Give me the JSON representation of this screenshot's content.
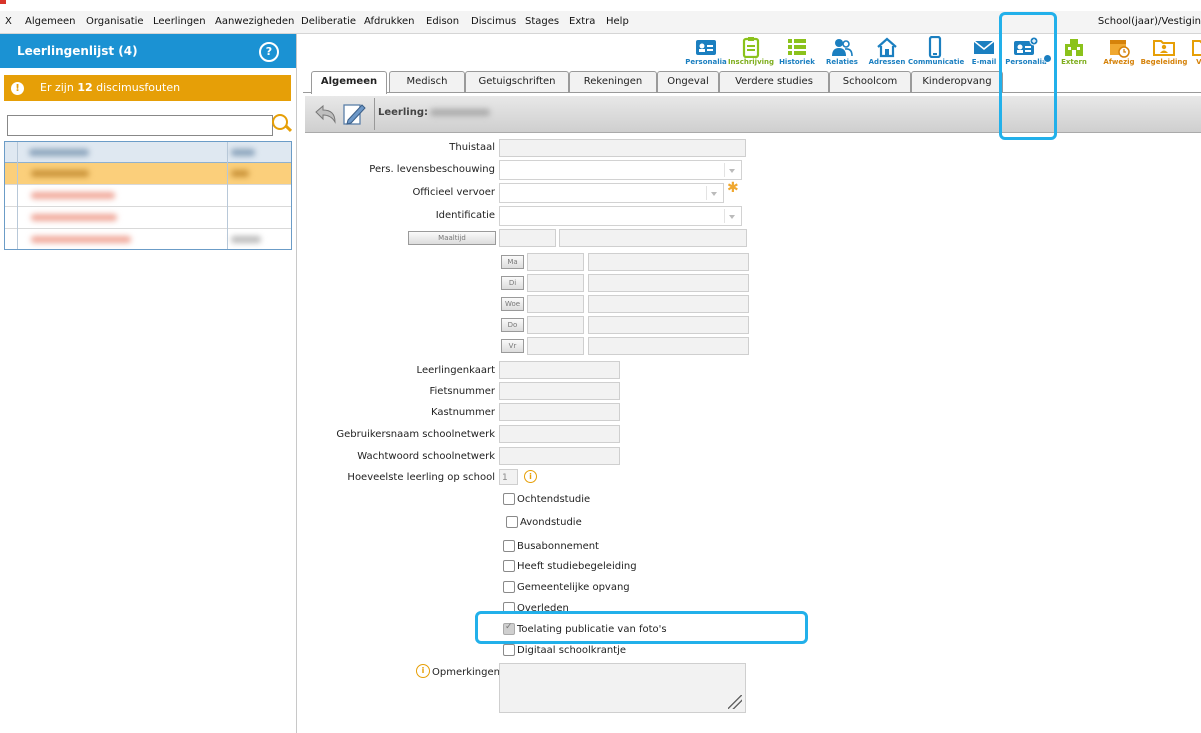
{
  "menubar": {
    "items": [
      "X",
      "Algemeen",
      "Organisatie",
      "Leerlingen",
      "Aanwezigheden",
      "Deliberatie",
      "Afdrukken",
      "Edison",
      "Discimus",
      "Stages",
      "Extra",
      "Help"
    ],
    "right": "School(jaar)/Vestigin"
  },
  "leftpane": {
    "title": "Leerlingenlijst (4)",
    "warning_prefix": "Er zijn ",
    "warning_count": "12",
    "warning_suffix": " discimusfouten",
    "search_value": ""
  },
  "toolbar": {
    "items": [
      {
        "label": "Personalia",
        "icon": "id-card-icon",
        "color": "#1b7fc0"
      },
      {
        "label": "Inschrijving",
        "icon": "clipboard-icon",
        "color": "#8bc21c"
      },
      {
        "label": "Historiek",
        "icon": "list-icon",
        "color": "#8bc21c"
      },
      {
        "label": "Relaties",
        "icon": "people-icon",
        "color": "#1b7fc0"
      },
      {
        "label": "Adressen",
        "icon": "house-icon",
        "color": "#1b7fc0"
      },
      {
        "label": "Communicatie",
        "icon": "phone-icon",
        "color": "#1b7fc0"
      },
      {
        "label": "E-mail",
        "icon": "envelope-icon",
        "color": "#1b7fc0"
      },
      {
        "label": "Personalia",
        "icon": "id-card-plus-icon",
        "color": "#1b7fc0"
      },
      {
        "label": "Extern",
        "icon": "building-icon",
        "color": "#8bc21c"
      },
      {
        "label": "Afwezig",
        "icon": "calendar-icon",
        "color": "#e69f07"
      },
      {
        "label": "Begeleiding",
        "icon": "folder-person-icon",
        "color": "#e69f07"
      },
      {
        "label": "Vrij",
        "icon": "folder-icon",
        "color": "#e69f07"
      }
    ]
  },
  "tabs": [
    "Algemeen",
    "Medisch",
    "Getuigschriften",
    "Rekeningen",
    "Ongeval",
    "Verdere studies",
    "Schoolcom",
    "Kinderopvang"
  ],
  "leerling_label": "Leerling:",
  "form": {
    "thuistaal": "Thuistaal",
    "levensbeschouwing": "Pers. levensbeschouwing",
    "vervoer": "Officieel vervoer",
    "identificatie": "Identificatie",
    "maaltijd_btn": "Maaltijd",
    "days": [
      "Ma",
      "Di",
      "Woe",
      "Do",
      "Vr"
    ],
    "leerlingenkaart": "Leerlingenkaart",
    "fietsnummer": "Fietsnummer",
    "kastnummer": "Kastnummer",
    "gebruikersnaam": "Gebruikersnaam schoolnetwerk",
    "wachtwoord": "Wachtwoord schoolnetwerk",
    "hoeveelste": "Hoeveelste leerling op school",
    "hoeveelste_value": "1",
    "checkboxes": [
      {
        "label": "Ochtendstudie",
        "checked": false
      },
      {
        "label": "Avondstudie",
        "checked": false
      },
      {
        "label": "Busabonnement",
        "checked": false
      },
      {
        "label": "Heeft studiebegeleiding",
        "checked": false
      },
      {
        "label": "Gemeentelijke opvang",
        "checked": false
      },
      {
        "label": "Overleden",
        "checked": false
      },
      {
        "label": "Toelating publicatie van foto's",
        "checked": true
      },
      {
        "label": "Digitaal schoolkrantje",
        "checked": false
      }
    ],
    "opmerkingen": "Opmerkingen"
  }
}
